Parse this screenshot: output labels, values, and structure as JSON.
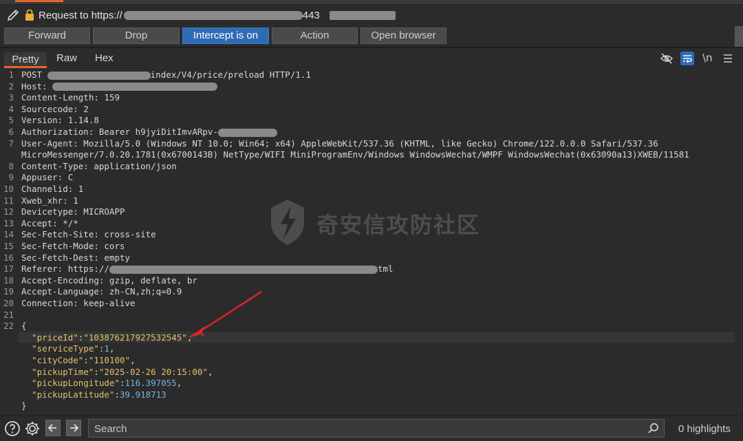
{
  "request": {
    "title_prefix": "Request to https://",
    "title_port": "443"
  },
  "toolbar": {
    "forward": "Forward",
    "drop": "Drop",
    "intercept": "Intercept is on",
    "action": "Action",
    "open_browser": "Open browser"
  },
  "tabs": [
    "Pretty",
    "Raw",
    "Hex"
  ],
  "toolbar_icons": [
    "eye-off-icon",
    "wrap-icon",
    "newline-icon",
    "menu-icon"
  ],
  "newline_label": "\\n",
  "lines": [
    {
      "n": "1",
      "seg": [
        {
          "t": "POST "
        },
        {
          "r": 150
        },
        {
          "t": "index/V4/price/preload HTTP/1.1"
        }
      ]
    },
    {
      "n": "2",
      "seg": [
        {
          "t": "Host: "
        },
        {
          "r": 240
        }
      ]
    },
    {
      "n": "3",
      "seg": [
        {
          "t": "Content-Length: 159"
        }
      ]
    },
    {
      "n": "4",
      "seg": [
        {
          "t": "Sourcecode: 2"
        }
      ]
    },
    {
      "n": "5",
      "seg": [
        {
          "t": "Version: 1.14.8"
        }
      ]
    },
    {
      "n": "6",
      "seg": [
        {
          "t": "Authorization: Bearer h9jyiDitImvARpv-"
        },
        {
          "r": 86
        }
      ]
    },
    {
      "n": "7",
      "seg": [
        {
          "t": "User-Agent: Mozilla/5.0 (Windows NT 10.0; Win64; x64) AppleWebKit/537.36 (KHTML, like Gecko) Chrome/122.0.0.0 Safari/537.36"
        }
      ]
    },
    {
      "n": "",
      "seg": [
        {
          "t": "MicroMessenger/7.0.20.1781(0x6700143B) NetType/WIFI MiniProgramEnv/Windows WindowsWechat/WMPF WindowsWechat(0x63090a13)XWEB/11581"
        }
      ]
    },
    {
      "n": "8",
      "seg": [
        {
          "t": "Content-Type: application/json"
        }
      ]
    },
    {
      "n": "9",
      "seg": [
        {
          "t": "Appuser: C"
        }
      ]
    },
    {
      "n": "10",
      "seg": [
        {
          "t": "Channelid: 1"
        }
      ]
    },
    {
      "n": "11",
      "seg": [
        {
          "t": "Xweb_xhr: 1"
        }
      ]
    },
    {
      "n": "12",
      "seg": [
        {
          "t": "Devicetype: MICROAPP"
        }
      ]
    },
    {
      "n": "13",
      "seg": [
        {
          "t": "Accept: */*"
        }
      ]
    },
    {
      "n": "14",
      "seg": [
        {
          "t": "Sec-Fetch-Site: cross-site"
        }
      ]
    },
    {
      "n": "15",
      "seg": [
        {
          "t": "Sec-Fetch-Mode: cors"
        }
      ]
    },
    {
      "n": "16",
      "seg": [
        {
          "t": "Sec-Fetch-Dest: empty"
        }
      ]
    },
    {
      "n": "17",
      "seg": [
        {
          "t": "Referer: https://"
        },
        {
          "r": 390
        },
        {
          "t": "tml"
        }
      ]
    },
    {
      "n": "18",
      "seg": [
        {
          "t": "Accept-Encoding: gzip, deflate, br"
        }
      ]
    },
    {
      "n": "19",
      "seg": [
        {
          "t": "Accept-Language: zh-CN,zh;q=0.9"
        }
      ]
    },
    {
      "n": "20",
      "seg": [
        {
          "t": "Connection: keep-alive"
        }
      ]
    },
    {
      "n": "21",
      "seg": []
    },
    {
      "n": "22",
      "seg": [
        {
          "t": "{"
        }
      ]
    },
    {
      "n": "",
      "hl": true,
      "seg": [
        {
          "t": "  "
        },
        {
          "c": "jk",
          "t": "\"priceId\""
        },
        {
          "t": ":"
        },
        {
          "c": "js",
          "t": "\"103876217927532545\""
        },
        {
          "t": ","
        }
      ]
    },
    {
      "n": "",
      "seg": [
        {
          "t": "  "
        },
        {
          "c": "jk",
          "t": "\"serviceType\""
        },
        {
          "t": ":"
        },
        {
          "c": "jn",
          "t": "1"
        },
        {
          "t": ","
        }
      ]
    },
    {
      "n": "",
      "seg": [
        {
          "t": "  "
        },
        {
          "c": "jk",
          "t": "\"cityCode\""
        },
        {
          "t": ":"
        },
        {
          "c": "js",
          "t": "\"110100\""
        },
        {
          "t": ","
        }
      ]
    },
    {
      "n": "",
      "seg": [
        {
          "t": "  "
        },
        {
          "c": "jk",
          "t": "\"pickupTime\""
        },
        {
          "t": ":"
        },
        {
          "c": "js",
          "t": "\"2025-02-26 20:15:00\""
        },
        {
          "t": ","
        }
      ]
    },
    {
      "n": "",
      "seg": [
        {
          "t": "  "
        },
        {
          "c": "jk",
          "t": "\"pickupLongitude\""
        },
        {
          "t": ":"
        },
        {
          "c": "jn",
          "t": "116.397055"
        },
        {
          "t": ","
        }
      ]
    },
    {
      "n": "",
      "seg": [
        {
          "t": "  "
        },
        {
          "c": "jk",
          "t": "\"pickupLatitude\""
        },
        {
          "t": ":"
        },
        {
          "c": "jn",
          "t": "39.918713"
        }
      ]
    },
    {
      "n": "",
      "seg": [
        {
          "t": "}"
        }
      ]
    }
  ],
  "watermark": "奇安信攻防社区",
  "search": {
    "placeholder": "Search"
  },
  "highlights": "0 highlights",
  "colors": {
    "accent": "#e8642b",
    "intercept_on": "#2f6bb5",
    "arrow": "#e0262a"
  }
}
